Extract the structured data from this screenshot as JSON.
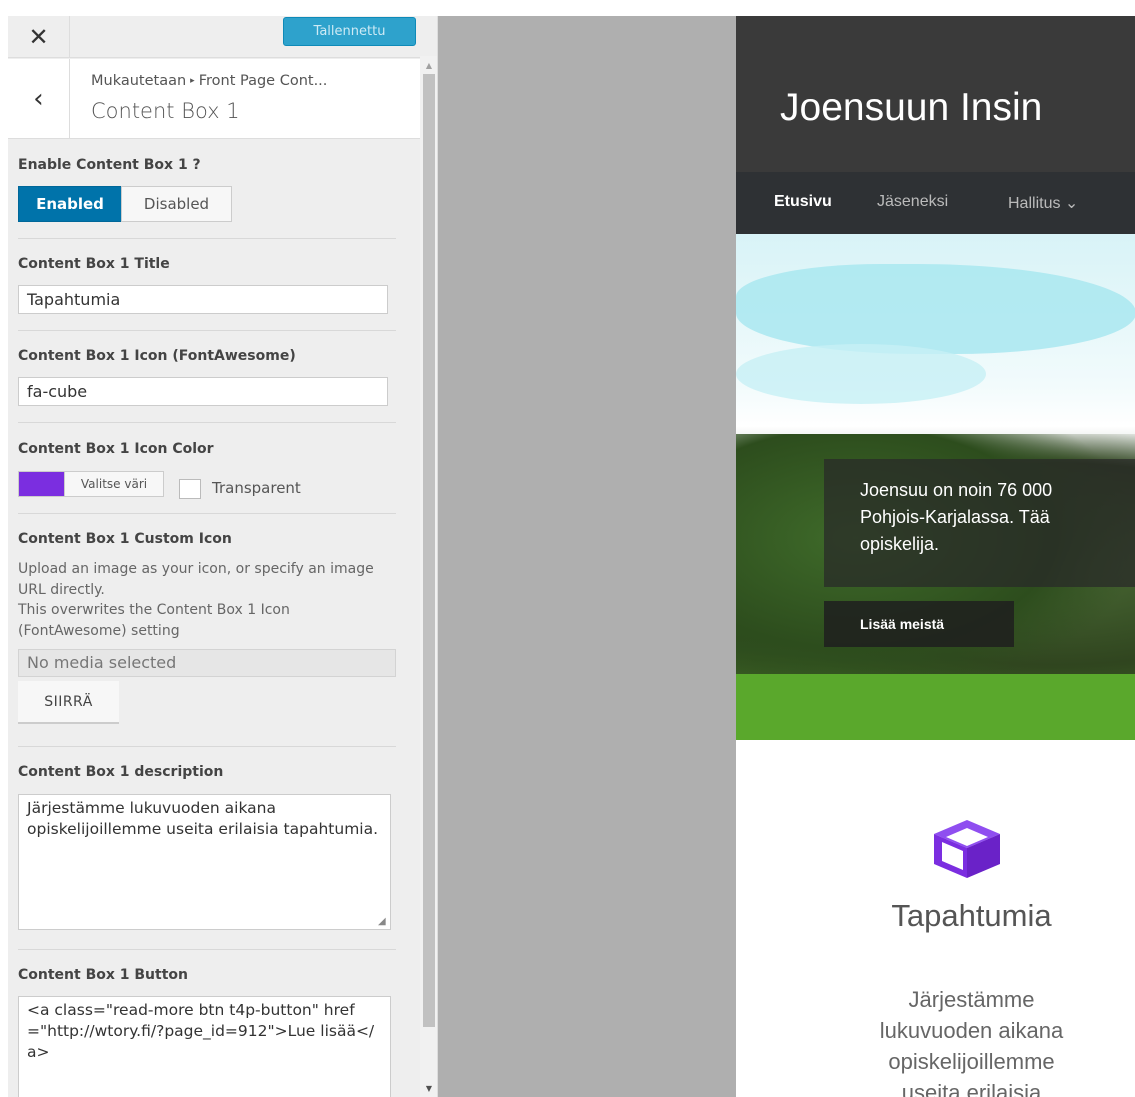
{
  "topbar": {
    "close_glyph": "✕",
    "save_label": "Tallennettu"
  },
  "section": {
    "back_glyph": "‹",
    "breadcrumb_root": "Mukautetaan",
    "breadcrumb_sep": "▸",
    "breadcrumb_parent": "Front Page Cont...",
    "title": "Content Box 1"
  },
  "controls": {
    "enable": {
      "label": "Enable Content Box 1 ?",
      "enabled_label": "Enabled",
      "disabled_label": "Disabled",
      "selected": "Enabled"
    },
    "title": {
      "label": "Content Box 1 Title",
      "value": "Tapahtumia"
    },
    "icon": {
      "label": "Content Box 1 Icon (FontAwesome)",
      "value": "fa-cube"
    },
    "icon_color": {
      "label": "Content Box 1 Icon Color",
      "swatch": "#7b2ee0",
      "button_label": "Valitse väri",
      "transparent_label": "Transparent",
      "transparent_checked": false
    },
    "custom_icon": {
      "label": "Content Box 1 Custom Icon",
      "description_line1": "Upload an image as your icon, or specify an image URL directly.",
      "description_line2": "This overwrites the Content Box 1 Icon (FontAwesome) setting",
      "media_placeholder": "No media selected",
      "move_button": "SIIRRÄ"
    },
    "description": {
      "label": "Content Box 1 description",
      "value": "Järjestämme lukuvuoden aikana opiskelijoillemme useita erilaisia tapahtumia."
    },
    "button": {
      "label": "Content Box 1 Button",
      "value": "<a class=\"read-more btn t4p-button\" href=\"http://wtory.fi/?page_id=912\">Lue lisää</a>"
    }
  },
  "preview": {
    "site_title": "Joensuun Insin",
    "nav": [
      {
        "label": "Etusivu",
        "active": true
      },
      {
        "label": "Jäseneksi",
        "active": false
      },
      {
        "label": "Hallitus ⌄",
        "active": false
      }
    ],
    "hero_lines": [
      "Joensuu on noin 76 000",
      "Pohjois-Karjalassa. Tää",
      "opiskelija."
    ],
    "hero_button": "Lisää meistä",
    "box_icon": "cube-icon",
    "box_icon_color": "#7b2ee0",
    "box_title": "Tapahtumia",
    "box_desc_lines": [
      "Järjestämme",
      "lukuvuoden aikana",
      "opiskelijoillemme",
      "useita erilaisia"
    ]
  }
}
